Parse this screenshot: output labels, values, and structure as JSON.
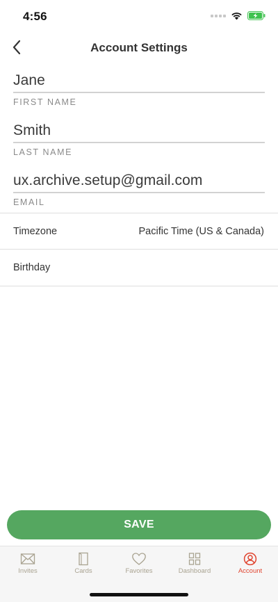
{
  "status_bar": {
    "time": "4:56"
  },
  "nav": {
    "title": "Account Settings",
    "back_icon": "chevron-left-icon"
  },
  "fields": [
    {
      "value": "Jane",
      "label": "FIRST NAME"
    },
    {
      "value": "Smith",
      "label": "LAST NAME"
    },
    {
      "value": "ux.archive.setup@gmail.com",
      "label": "EMAIL"
    }
  ],
  "rows": {
    "timezone": {
      "label": "Timezone",
      "value": "Pacific Time (US & Canada)"
    },
    "birthday": {
      "label": "Birthday"
    }
  },
  "save_label": "SAVE",
  "tabs": [
    {
      "label": "Invites",
      "icon": "envelope-icon"
    },
    {
      "label": "Cards",
      "icon": "card-icon"
    },
    {
      "label": "Favorites",
      "icon": "heart-icon"
    },
    {
      "label": "Dashboard",
      "icon": "grid-icon"
    },
    {
      "label": "Account",
      "icon": "user-circle-icon",
      "active": true
    }
  ],
  "colors": {
    "accent": "#55a760",
    "active_tab": "#e0442f",
    "inactive_tab": "#a9a391",
    "battery": "#3fc24f"
  }
}
